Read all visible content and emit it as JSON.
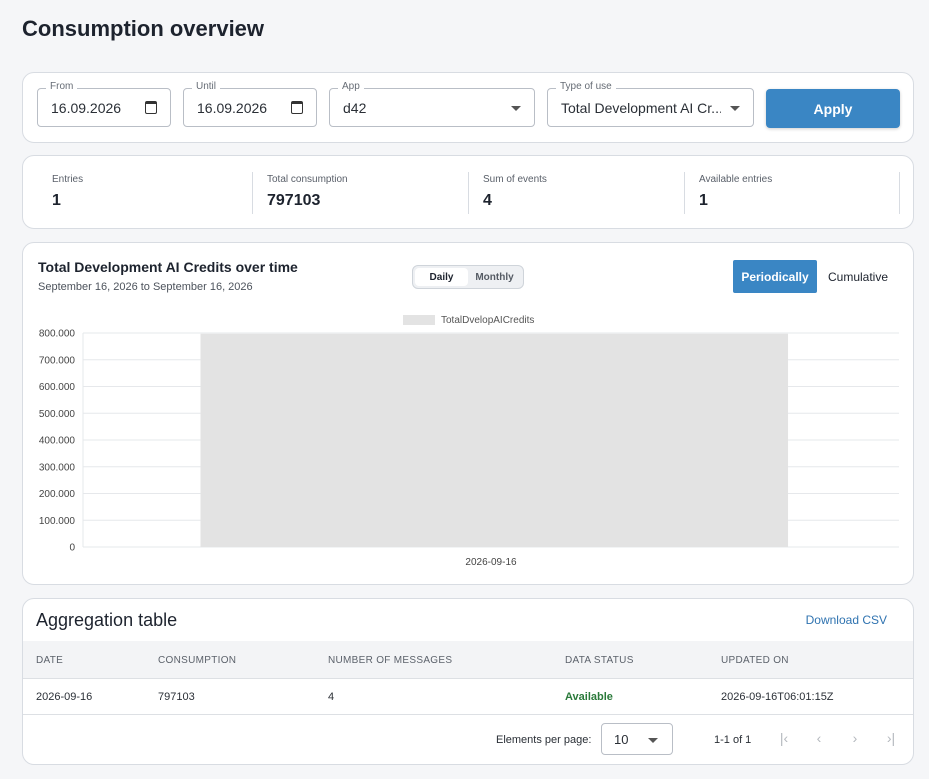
{
  "page": {
    "title": "Consumption overview"
  },
  "filters": {
    "from": {
      "label": "From",
      "value": "16.09.2026"
    },
    "until": {
      "label": "Until",
      "value": "16.09.2026"
    },
    "app": {
      "label": "App",
      "value": "d42"
    },
    "type_of_use": {
      "label": "Type of use",
      "value": "Total Development AI Cr..."
    },
    "apply_label": "Apply"
  },
  "stats": [
    {
      "label": "Entries",
      "value": "1"
    },
    {
      "label": "Total consumption",
      "value": "797103"
    },
    {
      "label": "Sum of events",
      "value": "4"
    },
    {
      "label": "Available entries",
      "value": "1"
    }
  ],
  "chart": {
    "title": "Total Development AI Credits over time",
    "subtitle": "September 16, 2026 to September 16, 2026",
    "granularity": {
      "daily": "Daily",
      "monthly": "Monthly",
      "selected": "Daily"
    },
    "mode": {
      "periodic": "Periodically",
      "cumulative": "Cumulative",
      "selected": "Periodically"
    }
  },
  "chart_data": {
    "type": "bar",
    "categories": [
      "2026-09-16"
    ],
    "series": [
      {
        "name": "TotalDvelopAICredits",
        "values": [
          797103
        ],
        "color": "#e3e3e3"
      }
    ],
    "yticks": [
      "0",
      "100.000",
      "200.000",
      "300.000",
      "400.000",
      "500.000",
      "600.000",
      "700.000",
      "800.000"
    ],
    "ylim": [
      0,
      800000
    ],
    "grid": true,
    "legend": "top-center"
  },
  "table": {
    "title": "Aggregation table",
    "download_label": "Download CSV",
    "columns": [
      "DATE",
      "CONSUMPTION",
      "NUMBER OF MESSAGES",
      "DATA STATUS",
      "UPDATED ON"
    ],
    "rows": [
      [
        "2026-09-16",
        "797103",
        "4",
        "Available",
        "2026-09-16T06:01:15Z"
      ]
    ],
    "pagination": {
      "per_page_label": "Elements per page:",
      "per_page_value": "10",
      "range": "1-1 of 1"
    }
  },
  "colors": {
    "accent": "#3a86c4",
    "status_available": "#2a7a3a",
    "bar": "#e3e3e3"
  }
}
